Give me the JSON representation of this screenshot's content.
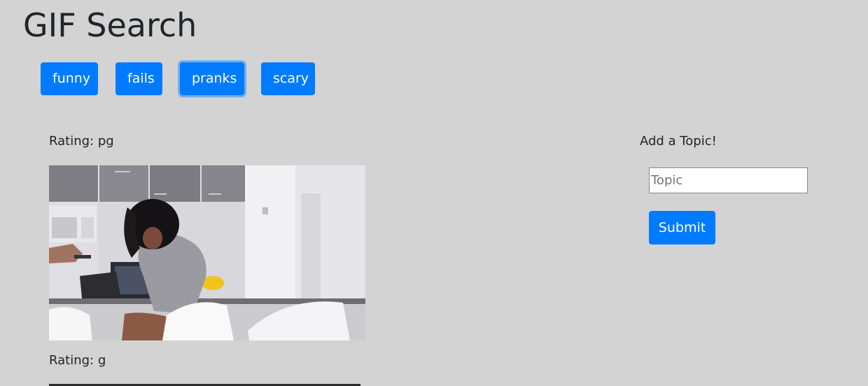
{
  "header": {
    "title": "GIF Search"
  },
  "topics": [
    {
      "label": "funny"
    },
    {
      "label": "fails"
    },
    {
      "label": "pranks"
    },
    {
      "label": "scary"
    }
  ],
  "results": [
    {
      "rating": "Rating: pg"
    },
    {
      "rating": "Rating: g"
    }
  ],
  "sidebar": {
    "heading": "Add a Topic!",
    "input_placeholder": "Topic",
    "input_value": "",
    "submit_label": "Submit"
  },
  "colors": {
    "background": "#d3d3d3",
    "button": "#007bff",
    "text": "#212529"
  }
}
